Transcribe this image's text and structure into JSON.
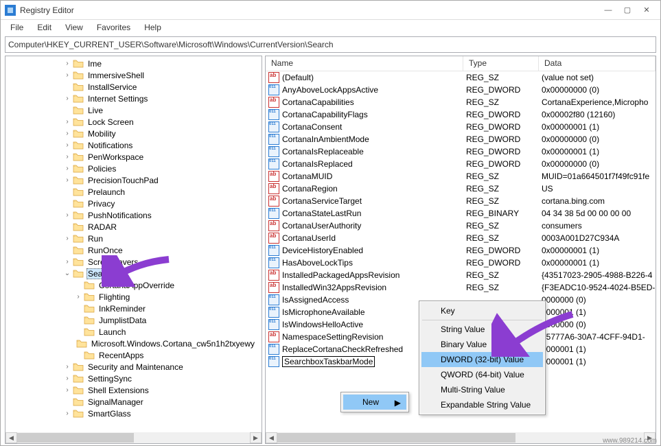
{
  "title": "Registry Editor",
  "menu": [
    "File",
    "Edit",
    "View",
    "Favorites",
    "Help"
  ],
  "path": "Computer\\HKEY_CURRENT_USER\\Software\\Microsoft\\Windows\\CurrentVersion\\Search",
  "tree": {
    "selected": "Search",
    "items": [
      {
        "depth": 5,
        "exp": ">",
        "label": "Ime"
      },
      {
        "depth": 5,
        "exp": ">",
        "label": "ImmersiveShell"
      },
      {
        "depth": 5,
        "exp": "",
        "label": "InstallService"
      },
      {
        "depth": 5,
        "exp": ">",
        "label": "Internet Settings"
      },
      {
        "depth": 5,
        "exp": "",
        "label": "Live"
      },
      {
        "depth": 5,
        "exp": ">",
        "label": "Lock Screen"
      },
      {
        "depth": 5,
        "exp": ">",
        "label": "Mobility"
      },
      {
        "depth": 5,
        "exp": ">",
        "label": "Notifications"
      },
      {
        "depth": 5,
        "exp": ">",
        "label": "PenWorkspace"
      },
      {
        "depth": 5,
        "exp": ">",
        "label": "Policies"
      },
      {
        "depth": 5,
        "exp": ">",
        "label": "PrecisionTouchPad"
      },
      {
        "depth": 5,
        "exp": "",
        "label": "Prelaunch"
      },
      {
        "depth": 5,
        "exp": "",
        "label": "Privacy"
      },
      {
        "depth": 5,
        "exp": ">",
        "label": "PushNotifications"
      },
      {
        "depth": 5,
        "exp": "",
        "label": "RADAR"
      },
      {
        "depth": 5,
        "exp": ">",
        "label": "Run"
      },
      {
        "depth": 5,
        "exp": "",
        "label": "RunOnce"
      },
      {
        "depth": 5,
        "exp": ">",
        "label": "Screensavers"
      },
      {
        "depth": 5,
        "exp": "v",
        "label": "Search",
        "sel": true
      },
      {
        "depth": 6,
        "exp": "",
        "label": "CortanaAppOverride"
      },
      {
        "depth": 6,
        "exp": ">",
        "label": "Flighting"
      },
      {
        "depth": 6,
        "exp": "",
        "label": "InkReminder"
      },
      {
        "depth": 6,
        "exp": "",
        "label": "JumplistData"
      },
      {
        "depth": 6,
        "exp": "",
        "label": "Launch"
      },
      {
        "depth": 6,
        "exp": "",
        "label": "Microsoft.Windows.Cortana_cw5n1h2txyewy"
      },
      {
        "depth": 6,
        "exp": "",
        "label": "RecentApps"
      },
      {
        "depth": 5,
        "exp": ">",
        "label": "Security and Maintenance"
      },
      {
        "depth": 5,
        "exp": ">",
        "label": "SettingSync"
      },
      {
        "depth": 5,
        "exp": ">",
        "label": "Shell Extensions"
      },
      {
        "depth": 5,
        "exp": "",
        "label": "SignalManager"
      },
      {
        "depth": 5,
        "exp": ">",
        "label": "SmartGlass"
      }
    ]
  },
  "list": {
    "headers": {
      "name": "Name",
      "type": "Type",
      "data": "Data"
    },
    "rows": [
      {
        "icon": "sz",
        "name": "(Default)",
        "type": "REG_SZ",
        "data": "(value not set)"
      },
      {
        "icon": "dw",
        "name": "AnyAboveLockAppsActive",
        "type": "REG_DWORD",
        "data": "0x00000000 (0)"
      },
      {
        "icon": "sz",
        "name": "CortanaCapabilities",
        "type": "REG_SZ",
        "data": "CortanaExperience,Micropho"
      },
      {
        "icon": "dw",
        "name": "CortanaCapabilityFlags",
        "type": "REG_DWORD",
        "data": "0x00002f80 (12160)"
      },
      {
        "icon": "dw",
        "name": "CortanaConsent",
        "type": "REG_DWORD",
        "data": "0x00000001 (1)"
      },
      {
        "icon": "dw",
        "name": "CortanaInAmbientMode",
        "type": "REG_DWORD",
        "data": "0x00000000 (0)"
      },
      {
        "icon": "dw",
        "name": "CortanaIsReplaceable",
        "type": "REG_DWORD",
        "data": "0x00000001 (1)"
      },
      {
        "icon": "dw",
        "name": "CortanaIsReplaced",
        "type": "REG_DWORD",
        "data": "0x00000000 (0)"
      },
      {
        "icon": "sz",
        "name": "CortanaMUID",
        "type": "REG_SZ",
        "data": "MUID=01a664501f7f49fc91fe"
      },
      {
        "icon": "sz",
        "name": "CortanaRegion",
        "type": "REG_SZ",
        "data": "US"
      },
      {
        "icon": "sz",
        "name": "CortanaServiceTarget",
        "type": "REG_SZ",
        "data": "cortana.bing.com"
      },
      {
        "icon": "dw",
        "name": "CortanaStateLastRun",
        "type": "REG_BINARY",
        "data": "04 34 38 5d 00 00 00 00"
      },
      {
        "icon": "sz",
        "name": "CortanaUserAuthority",
        "type": "REG_SZ",
        "data": "consumers"
      },
      {
        "icon": "sz",
        "name": "CortanaUserId",
        "type": "REG_SZ",
        "data": "0003A001D27C934A"
      },
      {
        "icon": "dw",
        "name": "DeviceHistoryEnabled",
        "type": "REG_DWORD",
        "data": "0x00000001 (1)"
      },
      {
        "icon": "dw",
        "name": "HasAboveLockTips",
        "type": "REG_DWORD",
        "data": "0x00000001 (1)"
      },
      {
        "icon": "sz",
        "name": "InstalledPackagedAppsRevision",
        "type": "REG_SZ",
        "data": "{43517023-2905-4988-B226-4"
      },
      {
        "icon": "sz",
        "name": "InstalledWin32AppsRevision",
        "type": "REG_SZ",
        "data": "{F3EADC10-9524-4024-B5ED-"
      },
      {
        "icon": "dw",
        "name": "IsAssignedAccess",
        "type": "",
        "data": "0000000 (0)"
      },
      {
        "icon": "dw",
        "name": "IsMicrophoneAvailable",
        "type": "",
        "data": "0000001 (1)"
      },
      {
        "icon": "dw",
        "name": "IsWindowsHelloActive",
        "type": "",
        "data": "0000000 (0)"
      },
      {
        "icon": "sz",
        "name": "NamespaceSettingRevision",
        "type": "",
        "data": "75777A6-30A7-4CFF-94D1-"
      },
      {
        "icon": "dw",
        "name": "ReplaceCortanaCheckRefreshed",
        "type": "",
        "data": "0000001 (1)"
      },
      {
        "icon": "dw",
        "name": "SearchboxTaskbarMode",
        "type": "",
        "data": "0000001 (1)",
        "editing": true
      }
    ]
  },
  "context_sub": {
    "label": "New",
    "arrow": "▶"
  },
  "context_menu": {
    "items": [
      {
        "label": "Key"
      },
      {
        "label": "String Value"
      },
      {
        "label": "Binary Value"
      },
      {
        "label": "DWORD (32-bit) Value",
        "hl": true
      },
      {
        "label": "QWORD (64-bit) Value"
      },
      {
        "label": "Multi-String Value"
      },
      {
        "label": "Expandable String Value"
      }
    ]
  },
  "watermark": "www.989214.com"
}
